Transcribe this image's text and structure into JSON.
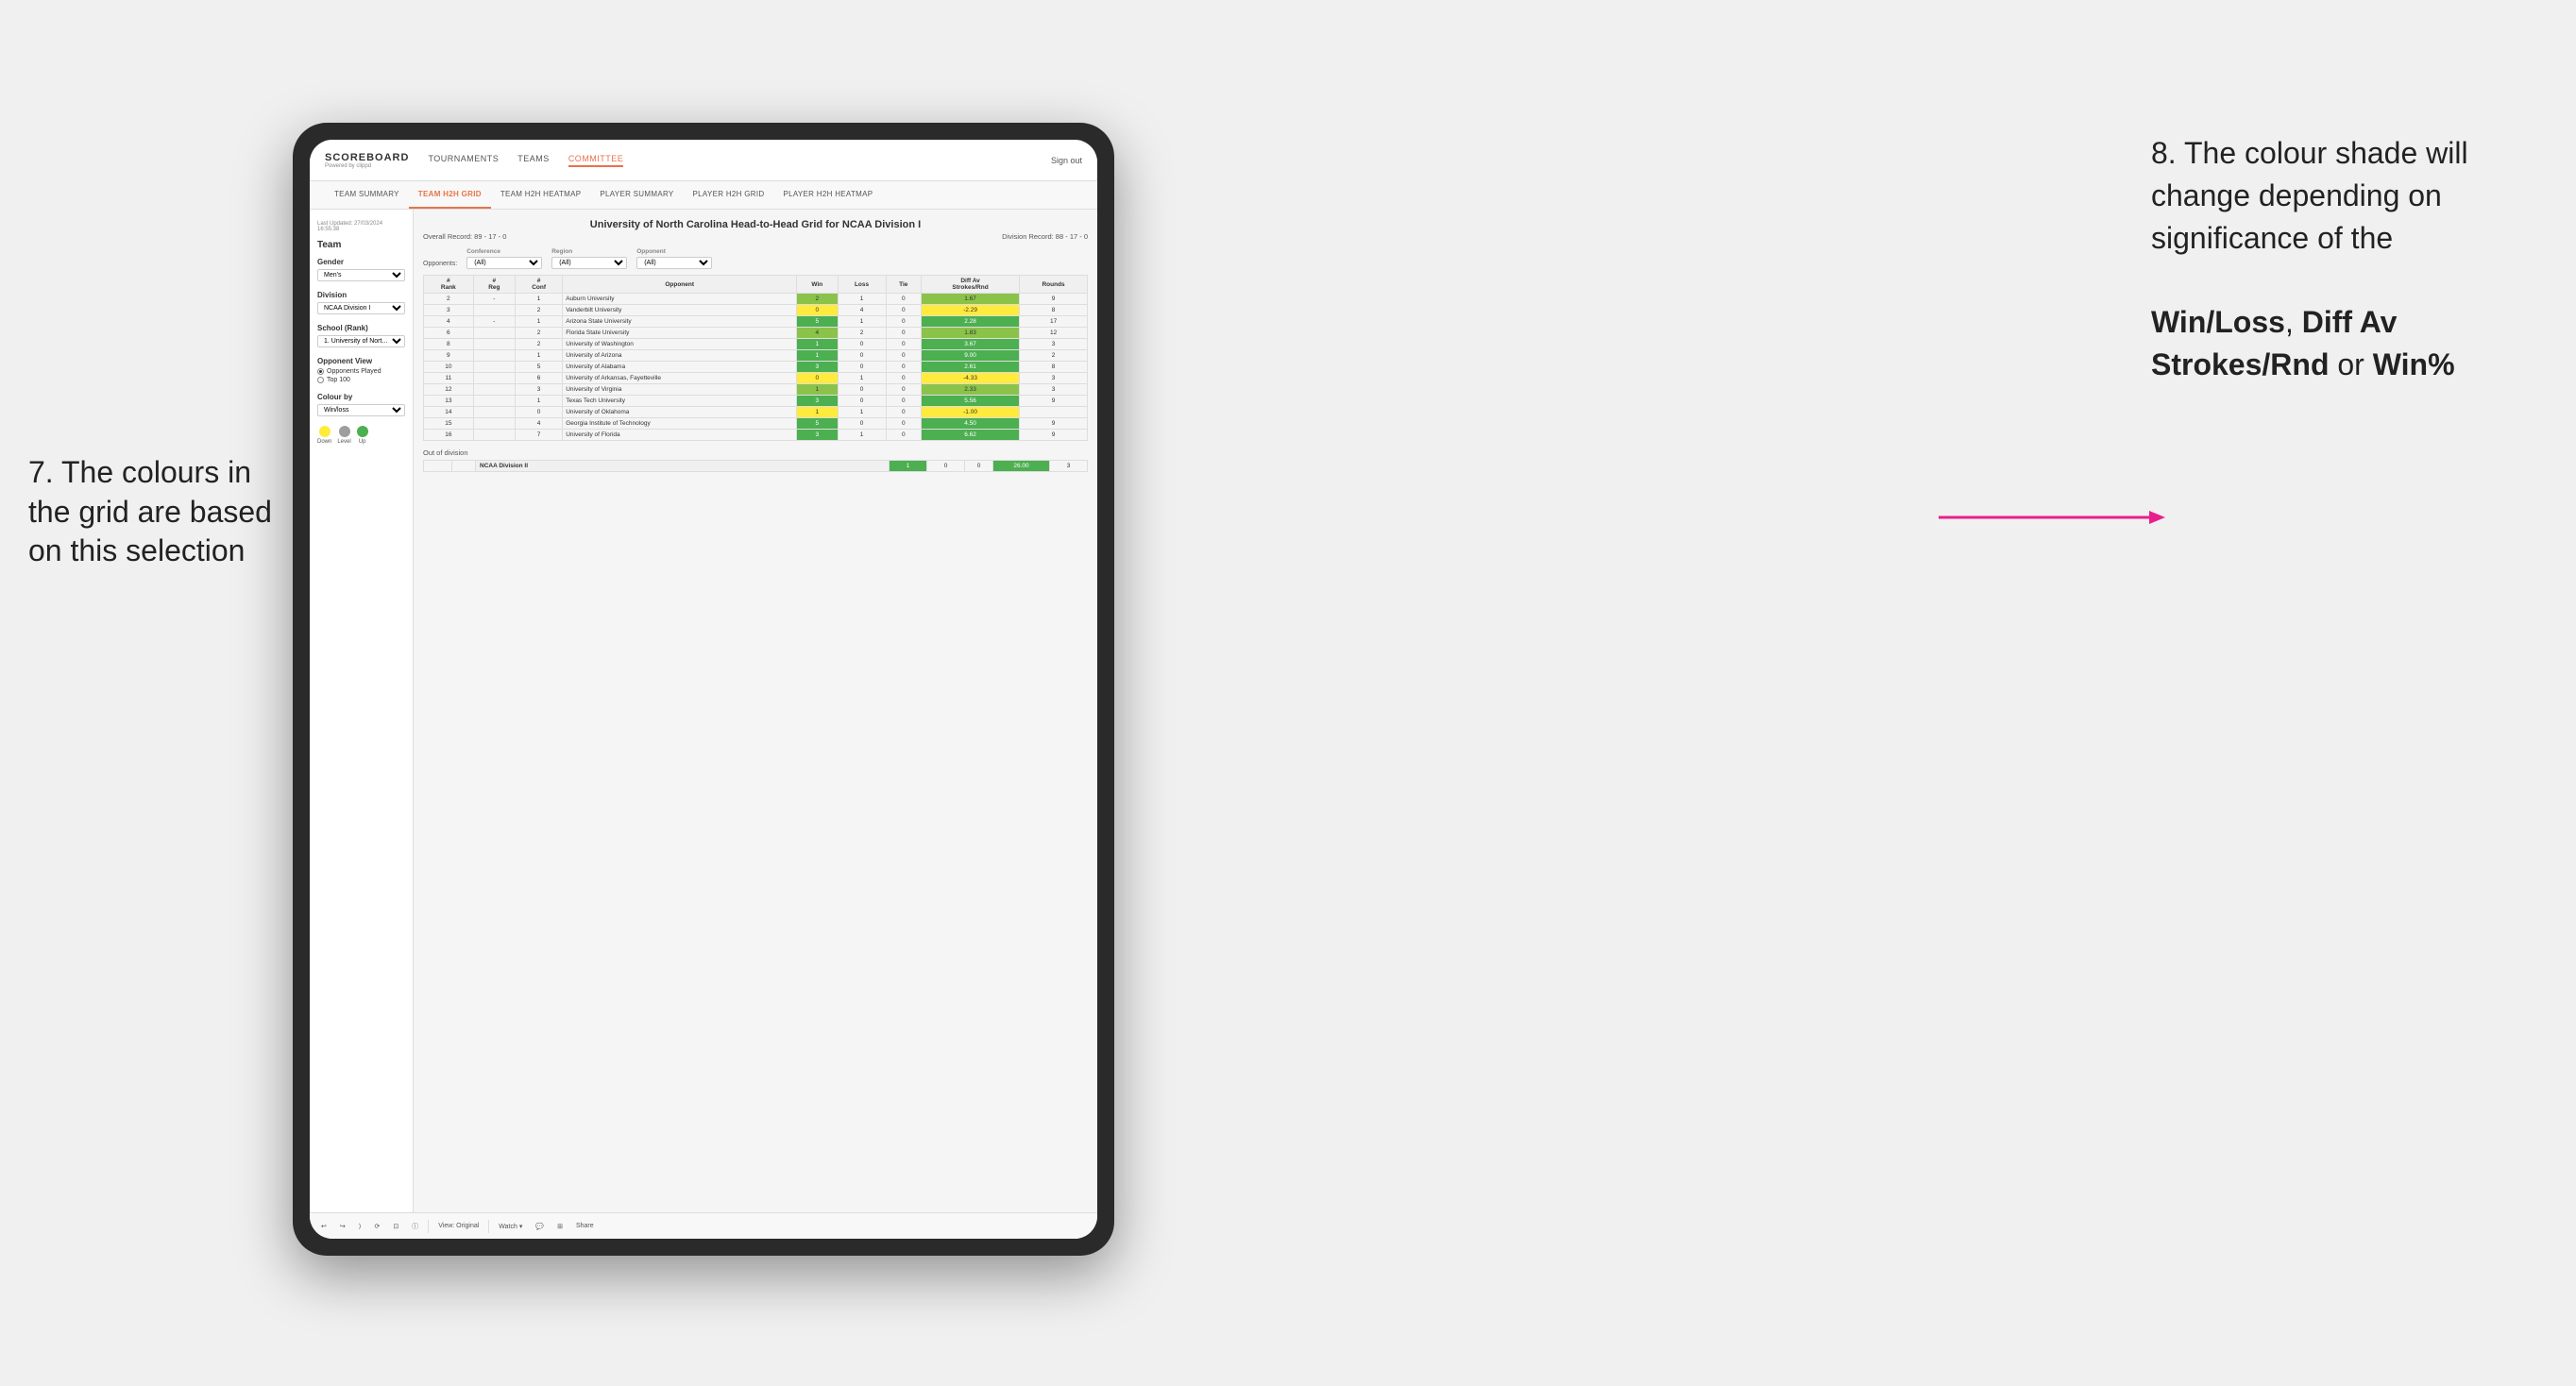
{
  "annotations": {
    "left_title": "7. The colours in the grid are based on this selection",
    "right_title": "8. The colour shade will change depending on significance of the",
    "right_bold1": "Win/Loss",
    "right_comma": ", ",
    "right_bold2": "Diff Av Strokes/Rnd",
    "right_or": " or ",
    "right_bold3": "Win%"
  },
  "nav": {
    "logo": "SCOREBOARD",
    "logo_sub": "Powered by clippd",
    "links": [
      "TOURNAMENTS",
      "TEAMS",
      "COMMITTEE"
    ],
    "sign_out": "Sign out"
  },
  "sub_tabs": [
    "TEAM SUMMARY",
    "TEAM H2H GRID",
    "TEAM H2H HEATMAP",
    "PLAYER SUMMARY",
    "PLAYER H2H GRID",
    "PLAYER H2H HEATMAP"
  ],
  "active_tab": "TEAM H2H GRID",
  "sidebar": {
    "timestamp": "Last Updated: 27/03/2024 16:55:38",
    "team_label": "Team",
    "gender_label": "Gender",
    "gender_value": "Men's",
    "division_label": "Division",
    "division_value": "NCAA Division I",
    "school_label": "School (Rank)",
    "school_value": "1. University of Nort...",
    "opponent_view_label": "Opponent View",
    "option1": "Opponents Played",
    "option2": "Top 100",
    "colour_by_label": "Colour by",
    "colour_by_value": "Win/loss",
    "legend": {
      "down": "Down",
      "level": "Level",
      "up": "Up"
    }
  },
  "grid": {
    "title": "University of North Carolina Head-to-Head Grid for NCAA Division I",
    "overall_record": "Overall Record: 89 - 17 - 0",
    "division_record": "Division Record: 88 - 17 - 0",
    "filters": {
      "conference_label": "Conference",
      "conference_value": "(All)",
      "region_label": "Region",
      "region_value": "(All)",
      "opponent_label": "Opponent",
      "opponent_value": "(All)",
      "opponents_label": "Opponents:"
    },
    "columns": [
      "#\nRank",
      "#\nReg",
      "#\nConf",
      "Opponent",
      "Win",
      "Loss",
      "Tie",
      "Diff Av\nStrokes/Rnd",
      "Rounds"
    ],
    "rows": [
      {
        "rank": "2",
        "reg": "-",
        "conf": "1",
        "opponent": "Auburn University",
        "win": "2",
        "loss": "1",
        "tie": "0",
        "diff": "1.67",
        "rounds": "9"
      },
      {
        "rank": "3",
        "reg": "",
        "conf": "2",
        "opponent": "Vanderbilt University",
        "win": "0",
        "loss": "4",
        "tie": "0",
        "diff": "-2.29",
        "rounds": "8"
      },
      {
        "rank": "4",
        "reg": "-",
        "conf": "1",
        "opponent": "Arizona State University",
        "win": "5",
        "loss": "1",
        "tie": "0",
        "diff": "2.28",
        "rounds": "17"
      },
      {
        "rank": "6",
        "reg": "",
        "conf": "2",
        "opponent": "Florida State University",
        "win": "4",
        "loss": "2",
        "tie": "0",
        "diff": "1.83",
        "rounds": "12"
      },
      {
        "rank": "8",
        "reg": "",
        "conf": "2",
        "opponent": "University of Washington",
        "win": "1",
        "loss": "0",
        "tie": "0",
        "diff": "3.67",
        "rounds": "3"
      },
      {
        "rank": "9",
        "reg": "",
        "conf": "1",
        "opponent": "University of Arizona",
        "win": "1",
        "loss": "0",
        "tie": "0",
        "diff": "9.00",
        "rounds": "2"
      },
      {
        "rank": "10",
        "reg": "",
        "conf": "5",
        "opponent": "University of Alabama",
        "win": "3",
        "loss": "0",
        "tie": "0",
        "diff": "2.61",
        "rounds": "8"
      },
      {
        "rank": "11",
        "reg": "",
        "conf": "6",
        "opponent": "University of Arkansas, Fayetteville",
        "win": "0",
        "loss": "1",
        "tie": "0",
        "diff": "-4.33",
        "rounds": "3"
      },
      {
        "rank": "12",
        "reg": "",
        "conf": "3",
        "opponent": "University of Virginia",
        "win": "1",
        "loss": "0",
        "tie": "0",
        "diff": "2.33",
        "rounds": "3"
      },
      {
        "rank": "13",
        "reg": "",
        "conf": "1",
        "opponent": "Texas Tech University",
        "win": "3",
        "loss": "0",
        "tie": "0",
        "diff": "5.56",
        "rounds": "9"
      },
      {
        "rank": "14",
        "reg": "",
        "conf": "0",
        "opponent": "University of Oklahoma",
        "win": "1",
        "loss": "1",
        "tie": "0",
        "diff": "-1.00",
        "rounds": ""
      },
      {
        "rank": "15",
        "reg": "",
        "conf": "4",
        "opponent": "Georgia Institute of Technology",
        "win": "5",
        "loss": "0",
        "tie": "0",
        "diff": "4.50",
        "rounds": "9"
      },
      {
        "rank": "16",
        "reg": "",
        "conf": "7",
        "opponent": "University of Florida",
        "win": "3",
        "loss": "1",
        "tie": "0",
        "diff": "6.62",
        "rounds": "9"
      }
    ],
    "out_of_division_label": "Out of division",
    "out_of_division_row": {
      "division": "NCAA Division II",
      "win": "1",
      "loss": "0",
      "tie": "0",
      "diff": "26.00",
      "rounds": "3"
    }
  },
  "toolbar": {
    "view_label": "View: Original",
    "watch_label": "Watch ▾",
    "share_label": "Share"
  }
}
